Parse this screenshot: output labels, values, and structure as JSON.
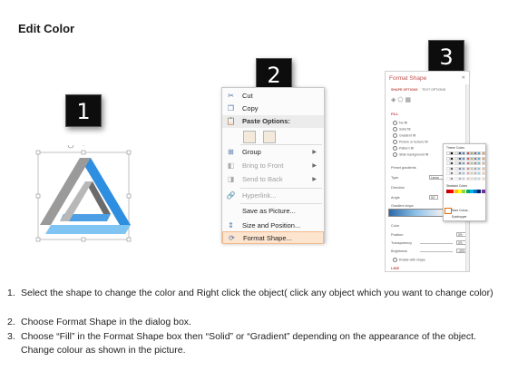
{
  "page": {
    "title": "Edit Color"
  },
  "badges": [
    "1",
    "2",
    "3"
  ],
  "shape": {
    "colors": {
      "blue": "#2e8ee0",
      "light_blue": "#7fc4f2",
      "gray": "#9a9a9a",
      "dark_gray": "#6b6b6b"
    }
  },
  "context_menu": {
    "items": [
      {
        "label": "Cut",
        "icon": "scissors-icon"
      },
      {
        "label": "Copy",
        "icon": "copy-icon"
      },
      {
        "label": "Paste Options:",
        "icon": "clipboard-icon"
      },
      {
        "label": "Group",
        "icon": "group-icon",
        "submenu": true
      },
      {
        "label": "Bring to Front",
        "icon": "bring-front-icon",
        "submenu": true,
        "disabled": true
      },
      {
        "label": "Send to Back",
        "icon": "send-back-icon",
        "submenu": true,
        "disabled": true
      },
      {
        "label": "Hyperlink...",
        "icon": "link-icon",
        "disabled": true
      },
      {
        "label": "Save as Picture...",
        "icon": ""
      },
      {
        "label": "Size and Position...",
        "icon": "size-position-icon"
      },
      {
        "label": "Format Shape...",
        "icon": "format-shape-icon",
        "active": true
      }
    ]
  },
  "format_pane": {
    "title": "Format Shape",
    "tabs": [
      "SHAPE OPTIONS",
      "TEXT OPTIONS"
    ],
    "fill_section": "FILL",
    "fill_options": [
      "No fill",
      "Solid fill",
      "Gradient fill",
      "Picture or texture fill",
      "Pattern fill",
      "Slide background fill"
    ],
    "labels": [
      "Preset gradients",
      "Type",
      "Direction",
      "Angle",
      "Gradient stops",
      "Color",
      "Position",
      "Transparency",
      "Brightness",
      "Rotate with shape"
    ],
    "values": {
      "type": "Linear",
      "angle": "90°",
      "position": "0%",
      "transparency": "0%",
      "brightness": "-40%"
    },
    "line_section": "LINE",
    "color_popup": {
      "theme_label": "Theme Colors",
      "standard_label": "Standard Colors",
      "more_label": "More Colors...",
      "eyedropper_label": "Eyedropper"
    }
  },
  "instructions": [
    {
      "num": "1.",
      "text": "Select the shape to change the color and Right click the object( click any object which you want to change color)"
    },
    {
      "num": "2.",
      "text": "Choose Format Shape in the dialog box."
    },
    {
      "num": "3.",
      "text": "Choose “Fill” in the Format Shape box then “Solid” or “Gradient” depending on the appearance of the object. Change colour as shown in the picture."
    }
  ]
}
